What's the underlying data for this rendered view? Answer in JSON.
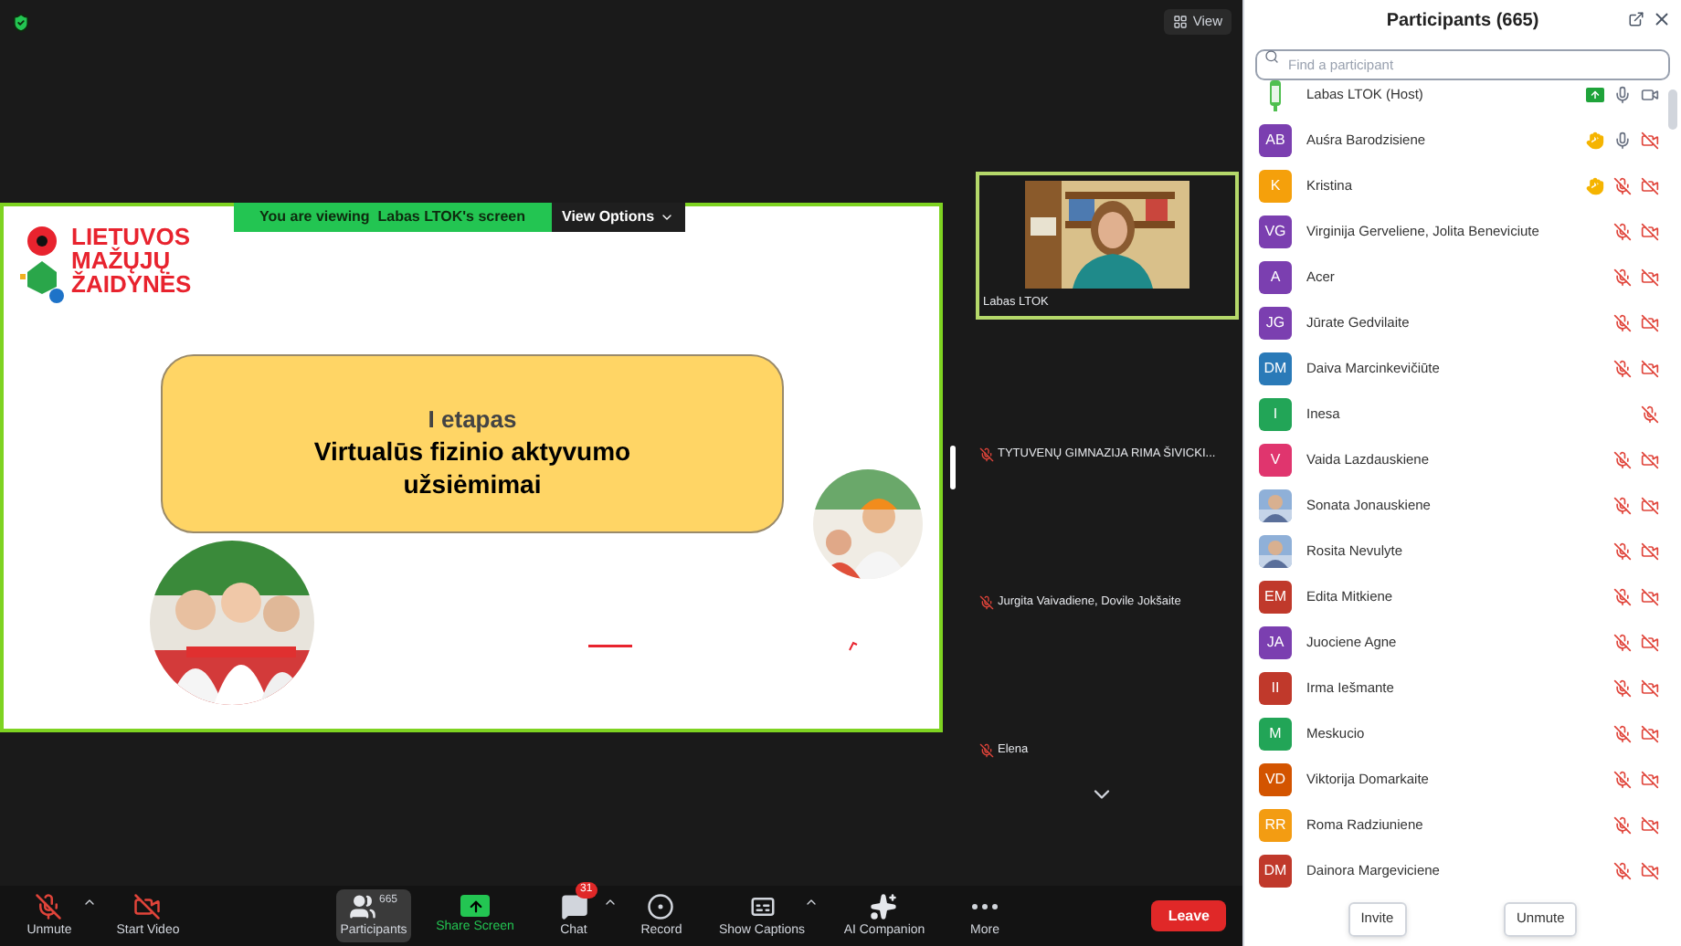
{
  "top_bar": {
    "view_button": "View"
  },
  "share_banner": {
    "text": "You are viewing  Labas LTOK's screen",
    "view_options": "View Options"
  },
  "slide": {
    "logo_lines": [
      "LIETUVOS",
      "MAŽŲJŲ",
      "ŽAIDYNĖS"
    ],
    "stage": "I etapas",
    "title": "Virtualūs fizinio aktyvumo užsiėmimai"
  },
  "video_tiles": [
    {
      "name": "Labas LTOK",
      "kind": "video",
      "muted": false,
      "active_speaker": true
    },
    {
      "name": "TYTUVENŲ GIMNAZIJA RIMA ŠIVICKI...",
      "kind": "label",
      "muted": true,
      "active_speaker": false
    },
    {
      "name": "Jurgita Vaivadiene, Dovile Jokšaite",
      "kind": "label",
      "muted": true,
      "active_speaker": false
    },
    {
      "name": "Elena",
      "kind": "label",
      "muted": true,
      "active_speaker": false
    }
  ],
  "toolbar": [
    {
      "kind": "mic",
      "label": "Unmute",
      "caret": true,
      "selected": false
    },
    {
      "kind": "video",
      "label": "Start Video",
      "caret": false,
      "selected": false
    },
    {
      "kind": "participants",
      "label": "Participants",
      "count": "665",
      "caret": false,
      "selected": true
    },
    {
      "kind": "share",
      "label": "Share Screen",
      "caret": false,
      "selected": false
    },
    {
      "kind": "chat",
      "label": "Chat",
      "badge": "31",
      "caret": true,
      "selected": false
    },
    {
      "kind": "record",
      "label": "Record",
      "caret": false,
      "selected": false
    },
    {
      "kind": "captions",
      "label": "Show Captions",
      "caret": true,
      "selected": false
    },
    {
      "kind": "ai",
      "label": "AI Companion",
      "caret": false,
      "selected": false
    },
    {
      "kind": "more",
      "label": "More",
      "caret": false,
      "selected": false
    }
  ],
  "leave_button": "Leave",
  "participants_panel": {
    "title": "Participants (665)",
    "search_placeholder": "Find a participant",
    "participants": [
      {
        "name": "Labas LTOK (Host)",
        "kind": "logo",
        "sharing": true,
        "hand_raised": false,
        "muted": false,
        "has_video": true,
        "video_off": false
      },
      {
        "name": "Auśra Barodzisiene",
        "kind": "initials",
        "initials": "AB",
        "color": "#7b3fb0",
        "sharing": false,
        "hand_raised": true,
        "muted": false,
        "has_video": true,
        "video_off": true
      },
      {
        "name": "Kristina",
        "kind": "initials",
        "initials": "K",
        "color": "#f5a00b",
        "sharing": false,
        "hand_raised": true,
        "muted": true,
        "has_video": true,
        "video_off": true
      },
      {
        "name": "Virginija Gerveliene, Jolita Beneviciute",
        "kind": "initials",
        "initials": "VG",
        "color": "#7b3fb0",
        "sharing": false,
        "hand_raised": false,
        "muted": true,
        "has_video": true,
        "video_off": true
      },
      {
        "name": "Acer",
        "kind": "initials",
        "initials": "A",
        "color": "#7b3fb0",
        "sharing": false,
        "hand_raised": false,
        "muted": true,
        "has_video": true,
        "video_off": true
      },
      {
        "name": "Jūrate Gedvilaite",
        "kind": "initials",
        "initials": "JG",
        "color": "#7b3fb0",
        "sharing": false,
        "hand_raised": false,
        "muted": true,
        "has_video": true,
        "video_off": true
      },
      {
        "name": "Daiva Marcinkevičiūte",
        "kind": "initials",
        "initials": "DM",
        "color": "#2a7ab8",
        "sharing": false,
        "hand_raised": false,
        "muted": true,
        "has_video": true,
        "video_off": true
      },
      {
        "name": "Inesa",
        "kind": "initials",
        "initials": "I",
        "color": "#22a557",
        "sharing": false,
        "hand_raised": false,
        "muted": true,
        "has_video": false
      },
      {
        "name": "Vaida Lazdauskiene",
        "kind": "initials",
        "initials": "V",
        "color": "#e0356e",
        "sharing": false,
        "hand_raised": false,
        "muted": true,
        "has_video": true,
        "video_off": true
      },
      {
        "name": "Sonata Jonauskiene",
        "sharing": false,
        "hand_raised": false,
        "muted": true,
        "has_video": true,
        "video_off": true
      },
      {
        "name": "Rosita Nevulyte",
        "sharing": false,
        "hand_raised": false,
        "muted": true,
        "has_video": true,
        "video_off": true
      },
      {
        "name": "Edita Mitkiene",
        "kind": "initials",
        "initials": "EM",
        "color": "#c0392b",
        "sharing": false,
        "hand_raised": false,
        "muted": true,
        "has_video": true,
        "video_off": true
      },
      {
        "name": "Juociene Agne",
        "kind": "initials",
        "initials": "JA",
        "color": "#7b3fb0",
        "sharing": false,
        "hand_raised": false,
        "muted": true,
        "has_video": true,
        "video_off": true
      },
      {
        "name": "Irma Iešmante",
        "kind": "initials",
        "initials": "II",
        "color": "#c0392b",
        "sharing": false,
        "hand_raised": false,
        "muted": true,
        "has_video": true,
        "video_off": true
      },
      {
        "name": "Meskucio",
        "kind": "initials",
        "initials": "M",
        "color": "#22a557",
        "sharing": false,
        "hand_raised": false,
        "muted": true,
        "has_video": true,
        "video_off": true
      },
      {
        "name": "Viktorija Domarkaite",
        "kind": "initials",
        "initials": "VD",
        "color": "#d35400",
        "sharing": false,
        "hand_raised": false,
        "muted": true,
        "has_video": true,
        "video_off": true
      },
      {
        "name": "Roma Radziuniene",
        "kind": "initials",
        "initials": "RR",
        "color": "#f39c12",
        "sharing": false,
        "hand_raised": false,
        "muted": true,
        "has_video": true,
        "video_off": true
      },
      {
        "name": "Dainora Margeviciene",
        "kind": "initials",
        "initials": "DM",
        "color": "#c0392b",
        "sharing": false,
        "hand_raised": false,
        "muted": true,
        "has_video": true,
        "video_off": true
      }
    ],
    "buttons": [
      "Invite",
      "Unmute"
    ]
  }
}
